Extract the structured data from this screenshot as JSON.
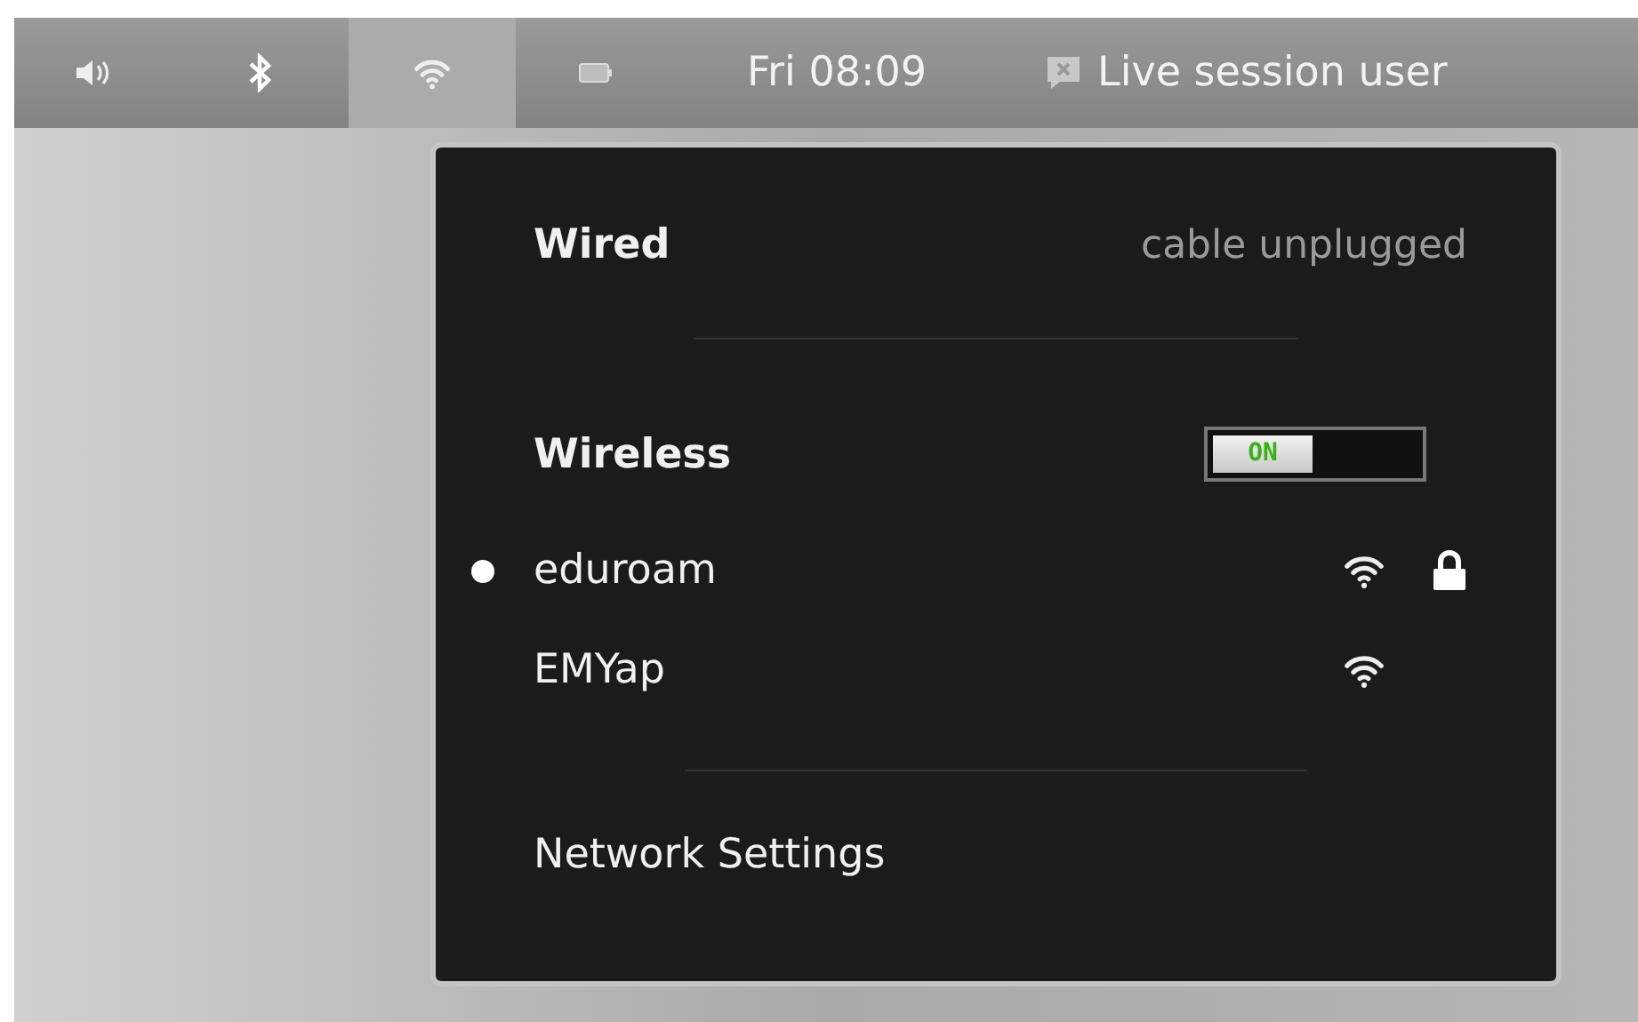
{
  "panel": {
    "indicators": [
      {
        "kind": "volume",
        "selected": false
      },
      {
        "kind": "bluetooth",
        "selected": false
      },
      {
        "kind": "wifi",
        "selected": true
      },
      {
        "kind": "battery",
        "selected": false
      }
    ],
    "clock": "Fri 08:09",
    "user": "Live session user"
  },
  "menu": {
    "wired": {
      "label": "Wired",
      "status": "cable unplugged"
    },
    "wireless": {
      "label": "Wireless",
      "on": true,
      "switch_label": "ON"
    },
    "networks": [
      {
        "name": "eduroam",
        "connected": true,
        "locked": true
      },
      {
        "name": "EMYap",
        "connected": false,
        "locked": false
      }
    ],
    "settings": "Network Settings"
  }
}
